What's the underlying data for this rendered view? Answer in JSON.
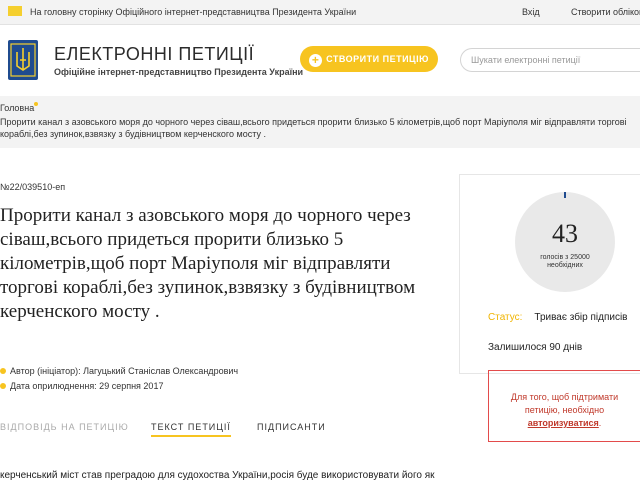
{
  "topbar": {
    "back_link": "На головну сторінку Офіційного інтернет-представництва Президента України",
    "login": "Вхід",
    "register": "Створити обліковий"
  },
  "header": {
    "title": "ЕЛЕКТРОННІ ПЕТИЦІЇ",
    "subtitle": "Офіційне інтернет-представництво Президента України",
    "create_button": "СТВОРИТИ ПЕТИЦІЮ",
    "search_placeholder": "Шукати електронні петиції"
  },
  "breadcrumb": {
    "home": "Головна",
    "current": "Прорити канал з азовського моря до чорного через сіваш,всього придеться прорити близько 5 кілометрів,щоб порт Маріуполя міг відправляти торгові кораблі,без зупинок,взвязку з будівництвом керченского мосту ."
  },
  "petition": {
    "number": "№22/039510-еп",
    "title": "Прорити канал з азовського моря до чорного через сіваш,всього придеться прорити близько 5 кілометрів,щоб порт Маріуполя міг відправляти торгові кораблі,без зупинок,взвязку з будівництвом керченского мосту .",
    "author": "Автор (ініціатор): Лагуцький Станіслав Олександрович",
    "date": "Дата оприлюднення: 29 серпня 2017",
    "body_start": "керченський міст став преградою для судохоства України,росія буде використовувати його як"
  },
  "tabs": [
    {
      "label": "ВІДПОВІДЬ НА ПЕТИЦІЮ"
    },
    {
      "label": "ТЕКСТ ПЕТИЦІЇ"
    },
    {
      "label": "ПІДПИСАНТИ"
    }
  ],
  "votes": {
    "count": "43",
    "label_line1": "голосів з 25000",
    "label_line2": "необхідних",
    "progress_fraction": 0.00172
  },
  "status": {
    "label": "Статус:",
    "value": "Триває збір підписів"
  },
  "remaining": "Залишилося 90 днів",
  "auth": {
    "line1": "Для того, щоб підтримати",
    "line2": "петицію, необхідно",
    "link": "авторизуватися",
    "tail": "."
  },
  "colors": {
    "accent": "#f7c420",
    "brand_blue": "#1f4b8f",
    "alert_red": "#e34b4b"
  }
}
